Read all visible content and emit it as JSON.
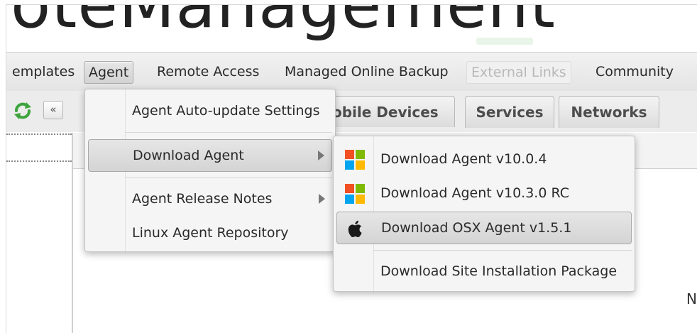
{
  "banner": {
    "title": "oteManagement"
  },
  "menubar": {
    "items": [
      {
        "label": "emplates"
      },
      {
        "label": "Agent"
      },
      {
        "label": "Remote Access"
      },
      {
        "label": "Managed Online Backup"
      },
      {
        "label": "External Links"
      },
      {
        "label": "Community"
      }
    ]
  },
  "toolbar": {
    "collapse_label": "«"
  },
  "tabs": [
    {
      "label": "obile Devices"
    },
    {
      "label": "Services"
    },
    {
      "label": "Networks"
    }
  ],
  "agent_menu": {
    "items": [
      {
        "label": "Agent Auto-update Settings"
      },
      {
        "label": "Download Agent"
      },
      {
        "label": "Agent Release Notes"
      },
      {
        "label": "Linux Agent Repository"
      }
    ]
  },
  "download_submenu": {
    "items": [
      {
        "label": "Download Agent v10.0.4",
        "icon": "windows-icon"
      },
      {
        "label": "Download Agent v10.3.0 RC",
        "icon": "windows-icon"
      },
      {
        "label": "Download OSX Agent v1.5.1",
        "icon": "apple-icon"
      },
      {
        "label": "Download Site Installation Package",
        "icon": ""
      }
    ]
  },
  "corner": {
    "text": "N"
  },
  "colors": {
    "win_red": "#f25022",
    "win_green": "#7fba00",
    "win_blue": "#00a4ef",
    "win_yellow": "#ffb900",
    "refresh_green": "#3ea43e"
  }
}
